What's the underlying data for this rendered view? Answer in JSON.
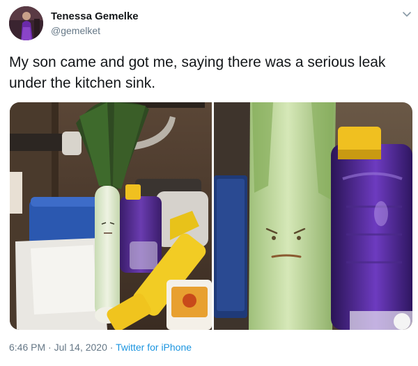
{
  "user": {
    "name": "Tenessa Gemelke",
    "handle": "@gemelket",
    "avatar": "profile-photo"
  },
  "tweet": {
    "text": "My son came and got me, saying there was a serious leak under the kitchen sink."
  },
  "media": {
    "count": 2,
    "photos": [
      "leek-under-sink-photo",
      "leek-closeup-photo"
    ]
  },
  "meta": {
    "time": "6:46 PM",
    "separator1": " · ",
    "date": "Jul 14, 2020",
    "separator2": " · ",
    "source": "Twitter for iPhone"
  },
  "icons": {
    "menu": "chevron-down-icon"
  },
  "colors": {
    "name": "#14171a",
    "secondary": "#657786",
    "link": "#1b95e0"
  }
}
